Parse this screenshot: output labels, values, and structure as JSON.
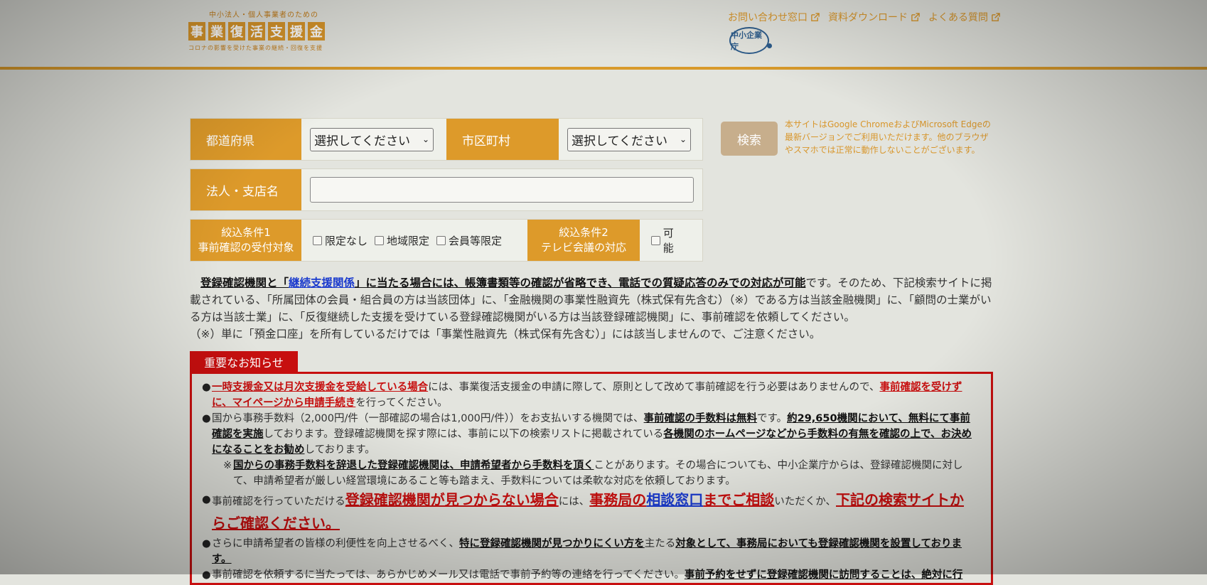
{
  "header": {
    "logo_top": "中小法人・個人事業者のための",
    "logo_chars": [
      "事",
      "業",
      "復",
      "活",
      "支",
      "援",
      "金"
    ],
    "logo_sub": "コロナの影響を受けた事業の継続・回復を支援",
    "nav": [
      "お問い合わせ窓口",
      "資料ダウンロード",
      "よくある質問"
    ],
    "agency": "中小企業庁"
  },
  "form": {
    "pref_label": "都道府県",
    "pref_value": "選択してください",
    "city_label": "市区町村",
    "city_value": "選択してください",
    "name_label": "法人・支店名",
    "name_value": "",
    "filter1_label": "絞込条件1\n事前確認の受付対象",
    "filter1_options": [
      "限定なし",
      "地域限定",
      "会員等限定"
    ],
    "filter2_label": "絞込条件2\nテレビ会議の対応",
    "filter2_options": [
      "可能"
    ],
    "search_label": "検索"
  },
  "browser_note": "本サイトはGoogle ChromeおよびMicrosoft Edgeの最新バージョンでご利用いただけます。他のブラウザやスマホでは正常に動作しないことがございます。",
  "intro": {
    "p1a": "登録確認機関と「",
    "p1link": "継続支援関係",
    "p1b": "」に当たる場合には、帳簿書類等の確認が省略でき、電話での質疑応答のみでの対応が可能",
    "p1c": "です。そのため、下記検索サイトに掲載されている、「所属団体の会員・組合員の方は当該団体」に、「金融機関の事業性融資先（株式保有先含む）（※）である方は当該金融機関」に、「顧問の士業がいる方は当該士業」に、「反復継続した支援を受けている登録確認機関がいる方は当該登録確認機関」に、事前確認を依頼してください。",
    "p2": "（※）単に「預金口座」を所有しているだけでは「事業性融資先（株式保有先含む）」には該当しませんので、ご注意ください。"
  },
  "notice": {
    "tab": "重要なお知らせ",
    "i1a": "一時支援金又は月次支援金を受給している場合",
    "i1b": "には、事業復活支援金の申請に際して、原則として改めて事前確認を行う必要はありませんので、",
    "i1c": "事前確認を受けずに、マイページから申請手続き",
    "i1d": "を行ってください。",
    "i2a": "国から事務手数料（2,000円/件（一部確認の場合は1,000円/件））をお支払いする機関では、",
    "i2b": "事前確認の手数料は無料",
    "i2c": "です。",
    "i2d": "約29,650機関において、無料にて事前確認を実施",
    "i2e": "しております。登録確認機関を探す際には、事前に以下の検索リストに掲載されている",
    "i2f": "各機関のホームページなどから手数料の有無を確認の上で、お決めになることをお勧め",
    "i2g": "しております。",
    "i2n1": "※",
    "i2n2": "国からの事務手数料を辞退した登録確認機関は、申請希望者から手数料を頂く",
    "i2n3": "ことがあります。その場合についても、中小企業庁からは、登録確認機関に対して、申請希望者が厳しい経営環境にあること等も踏まえ、手数料については柔軟な対応を依頼しております。",
    "i3a": "事前確認を行っていただける",
    "i3b": "登録確認機関が見つからない場合",
    "i3c": "には、",
    "i3d": "事務局の",
    "i3e": "相談窓口",
    "i3f": "までご相談",
    "i3g": "いただくか、",
    "i3h": "下記の検索サイトからご確認ください。",
    "i4a": "さらに申請希望者の皆様の利便性を向上させるべく、",
    "i4b": "特に登録確認機関が見つかりにくい方を",
    "i4c": "主たる",
    "i4d": "対象として、事務局においても登録確認機関を設置しております。",
    "i5a": "事前確認を依頼するに当たっては、あらかじめメール又は電話で事前予約等の連絡を行ってください。",
    "i5b": "事前予約をせずに登録確認機関に訪問することは、絶対に行"
  },
  "colors": {
    "accent": "#dd9a2a",
    "alert": "#c70f0f",
    "link": "#1a3acd"
  }
}
